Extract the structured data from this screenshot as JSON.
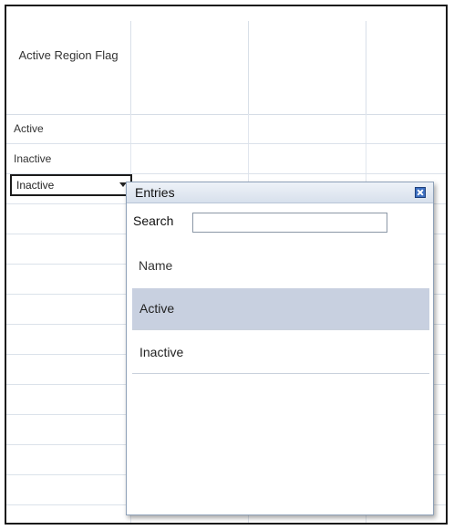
{
  "grid": {
    "header": "Active Region Flag",
    "rows": [
      "Active",
      "Inactive"
    ],
    "editing_value": "Inactive"
  },
  "popup": {
    "title": "Entries",
    "search_label": "Search",
    "search_value": "",
    "column_header": "Name",
    "options": [
      "Active",
      "Inactive"
    ],
    "selected_option": "Active"
  },
  "colors": {
    "selected_row": "#c8d0e0",
    "close_button": "#3e70c2",
    "frame_border": "#1a1a1a"
  }
}
